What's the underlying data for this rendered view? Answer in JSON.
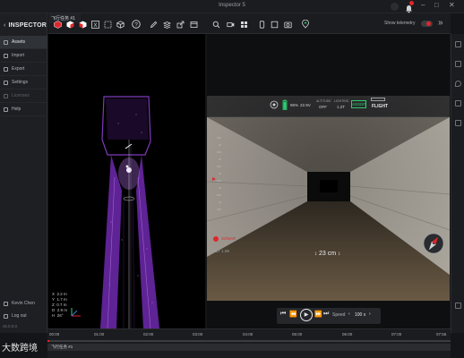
{
  "window": {
    "title": "Inspector 5"
  },
  "sidebar": {
    "brand": "INSPECTOR",
    "items": [
      {
        "label": "Assets",
        "active": true,
        "icon": "grid-icon"
      },
      {
        "label": "Import",
        "active": false,
        "icon": "import-icon"
      },
      {
        "label": "Export",
        "active": false,
        "icon": "export-icon"
      },
      {
        "label": "Settings",
        "active": false,
        "icon": "gear-icon"
      },
      {
        "label": "Licenses",
        "active": false,
        "disabled": true,
        "icon": "key-icon"
      },
      {
        "label": "Help",
        "active": false,
        "icon": "help-icon"
      }
    ],
    "user": "Kevin Chen",
    "logout": "Log out",
    "version": "v5.0.0.0"
  },
  "toolbar": {
    "tab_label": "飞行任务 #1",
    "show_telemetry": "Show telemetry",
    "telemetry_on": true,
    "icons": [
      "cube-red-icon",
      "cube-red-icon",
      "cube-red-icon",
      "axis-icon",
      "box-outline-icon",
      "box-3d-icon",
      "help-circle-icon",
      "pencil-icon",
      "stack-icon",
      "export-icon",
      "window-icon",
      "search-icon",
      "camera-icon",
      "grid-icon",
      "phone-icon",
      "square-icon",
      "photo-icon",
      "add-point-icon"
    ]
  },
  "view3d": {
    "legend": [
      {
        "axis": "X",
        "value": "2.2 m"
      },
      {
        "axis": "Y",
        "value": "1.7 m"
      },
      {
        "axis": "Z",
        "value": "0.7 m"
      },
      {
        "axis": "D",
        "value": "2.9 m"
      },
      {
        "axis": "H",
        "value": "26°"
      }
    ]
  },
  "camera": {
    "battery": "95%",
    "voltage": "22.9V",
    "alt_mode_label": "ALTITUDE",
    "alt_mode_value": "OFF",
    "lighting_label": "LIGHTING",
    "lighting_value": "1.2T",
    "assist": "ASSIST",
    "flight": "FLIGHT",
    "sonar_label": "SONAR",
    "alt_readout": "ALT 1.08",
    "distance": "23 cm",
    "accent_red": "#e0262b",
    "accent_green": "#2ecc71"
  },
  "playback": {
    "speed_label": "Speed",
    "speed_value": "100 x"
  },
  "timeline": {
    "ticks": [
      "00:00",
      "01:00",
      "02:00",
      "03:00",
      "04:00",
      "05:00",
      "06:00",
      "07:00",
      "07:56"
    ],
    "track_label": "飞行任务 #1",
    "progress": 0.0
  },
  "watermark": "大数跨境"
}
